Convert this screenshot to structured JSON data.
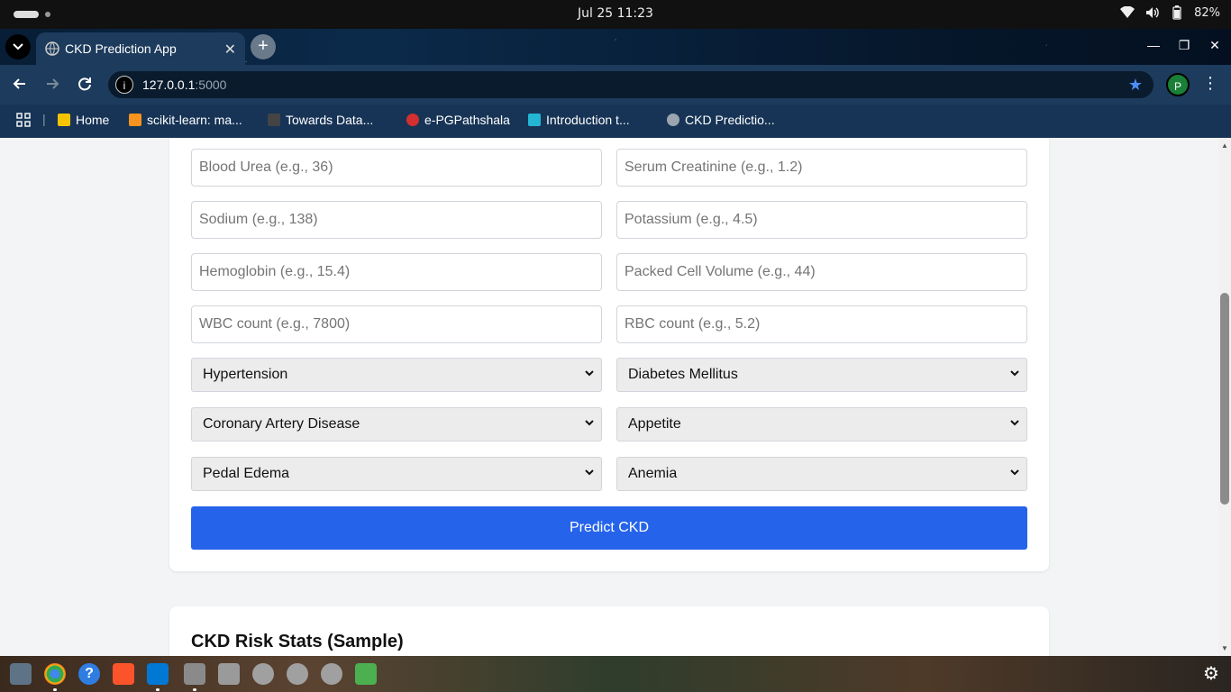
{
  "system": {
    "clock": "Jul 25  11:23",
    "battery": "82%"
  },
  "browser": {
    "tab_title": "CKD Prediction App",
    "url_host": "127.0.0.1",
    "url_port": ":5000",
    "profile_initial": "P",
    "bookmarks": [
      {
        "label": "Home",
        "color": "#f5c400"
      },
      {
        "label": "scikit-learn: ma...",
        "color": "#f7931e"
      },
      {
        "label": "Towards Data...",
        "color": "#444444"
      },
      {
        "label": "e-PGPathshala",
        "color": "#d32f2f"
      },
      {
        "label": "Introduction t...",
        "color": "#23b5d3"
      },
      {
        "label": "CKD Predictio...",
        "color": "#9aa5b1"
      }
    ]
  },
  "form": {
    "fields": [
      {
        "placeholder": "Blood Urea (e.g., 36)"
      },
      {
        "placeholder": "Serum Creatinine (e.g., 1.2)"
      },
      {
        "placeholder": "Sodium (e.g., 138)"
      },
      {
        "placeholder": "Potassium (e.g., 4.5)"
      },
      {
        "placeholder": "Hemoglobin (e.g., 15.4)"
      },
      {
        "placeholder": "Packed Cell Volume (e.g., 44)"
      },
      {
        "placeholder": "WBC count (e.g., 7800)"
      },
      {
        "placeholder": "RBC count (e.g., 5.2)"
      }
    ],
    "selects": [
      {
        "value": "Hypertension"
      },
      {
        "value": "Diabetes Mellitus"
      },
      {
        "value": "Coronary Artery Disease"
      },
      {
        "value": "Appetite"
      },
      {
        "value": "Pedal Edema"
      },
      {
        "value": "Anemia"
      }
    ],
    "submit_label": "Predict CKD"
  },
  "stats": {
    "title": "CKD Risk Stats (Sample)"
  },
  "colors": {
    "primary_button": "#2563eb",
    "chrome_bg": "#1d3b5c"
  }
}
